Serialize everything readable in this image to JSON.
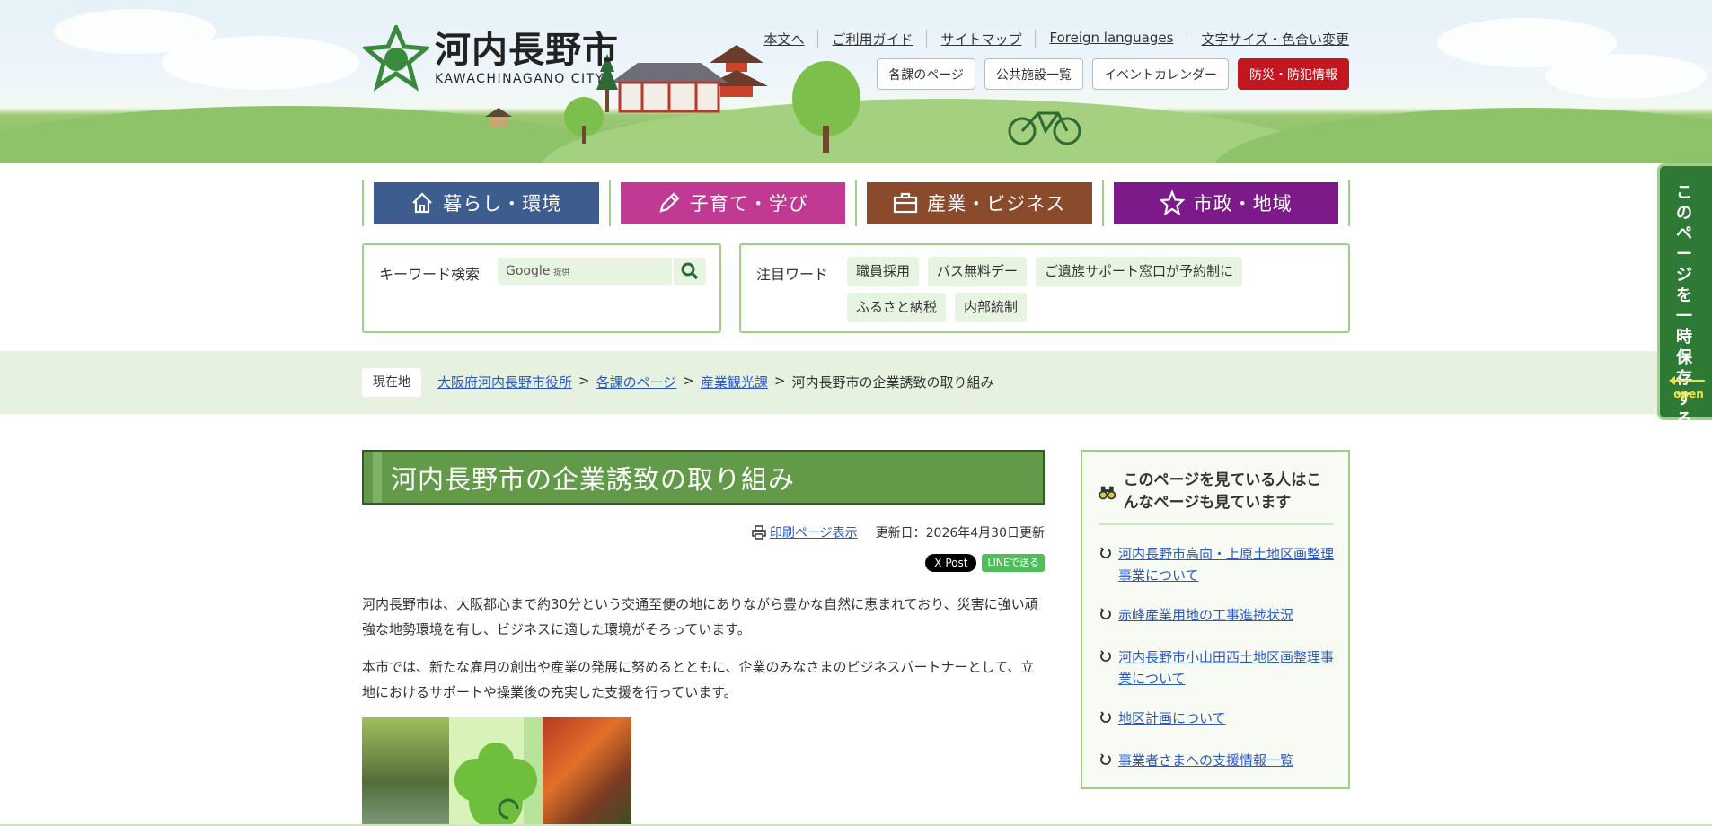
{
  "header": {
    "logo_jp": "河内長野市",
    "logo_en": "KAWACHINAGANO CITY",
    "util_links": [
      "本文へ",
      "ご利用ガイド",
      "サイトマップ",
      "Foreign languages",
      "文字サイズ・色合い変更"
    ],
    "util_buttons": [
      "各課のページ",
      "公共施設一覧",
      "イベントカレンダー",
      "防災・防犯情報"
    ]
  },
  "gnav": [
    {
      "label": "暮らし・環境",
      "color": "#3d5d8e",
      "icon": "house-icon"
    },
    {
      "label": "子育て・学び",
      "color": "#c03a93",
      "icon": "pencil-icon"
    },
    {
      "label": "産業・ビジネス",
      "color": "#8a4a2c",
      "icon": "briefcase-icon"
    },
    {
      "label": "市政・地域",
      "color": "#7d1a8a",
      "icon": "star-icon"
    }
  ],
  "search": {
    "label": "キーワード検索",
    "placeholder": "Google",
    "provider": "提供"
  },
  "keywords": {
    "label": "注目ワード",
    "tags": [
      "職員採用",
      "バス無料デー",
      "ご遺族サポート窓口が予約制に",
      "ふるさと納税",
      "内部統制"
    ]
  },
  "breadcrumb": {
    "here": "現在地",
    "links": [
      "大阪府河内長野市役所",
      "各課のページ",
      "産業観光課"
    ],
    "current": "河内長野市の企業誘致の取り組み",
    "sep": ">"
  },
  "main": {
    "title": "河内長野市の企業誘致の取り組み",
    "print_link": "印刷ページ表示",
    "updated": "更新日：2026年4月30日更新",
    "share_x": "X Post",
    "share_line": "LINEで送る",
    "paragraphs": [
      "河内長野市は、大阪都心まで約30分という交通至便の地にありながら豊かな自然に恵まれており、災害に強い頑強な地勢環境を有し、ビジネスに適した環境がそろっています。",
      "本市では、新たな雇用の創出や産業の発展に努めるとともに、企業のみなさまのビジネスパートナーとして、立地におけるサポートや操業後の充実した支援を行っています。"
    ]
  },
  "sidebar": {
    "heading": "このページを見ている人はこんなページも見ています",
    "links": [
      "河内長野市高向・上原土地区画整理事業について",
      "赤峰産業用地の工事進捗状況",
      "河内長野市小山田西土地区画整理事業について",
      "地区計画について",
      "事業者さまへの支援情報一覧"
    ]
  },
  "float_tab": {
    "label": "このページを一時保存する",
    "open": "open"
  },
  "colors": {
    "accent_green": "#639a4a",
    "frame_green": "#9ed08a",
    "emergency_red": "#c3161e",
    "link_blue": "#2b59c3"
  }
}
